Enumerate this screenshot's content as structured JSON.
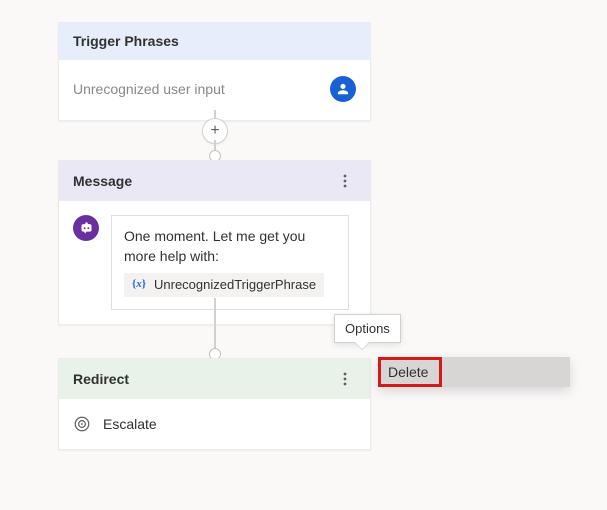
{
  "trigger": {
    "header": "Trigger Phrases",
    "placeholder_text": "Unrecognized user input"
  },
  "message": {
    "header": "Message",
    "body_text": "One moment. Let me get you more help with:",
    "variable_symbol": "{x}",
    "variable_name": "UnrecognizedTriggerPhrase"
  },
  "redirect": {
    "header": "Redirect",
    "action": "Escalate"
  },
  "tooltip": "Options",
  "menu": {
    "delete": "Delete"
  }
}
